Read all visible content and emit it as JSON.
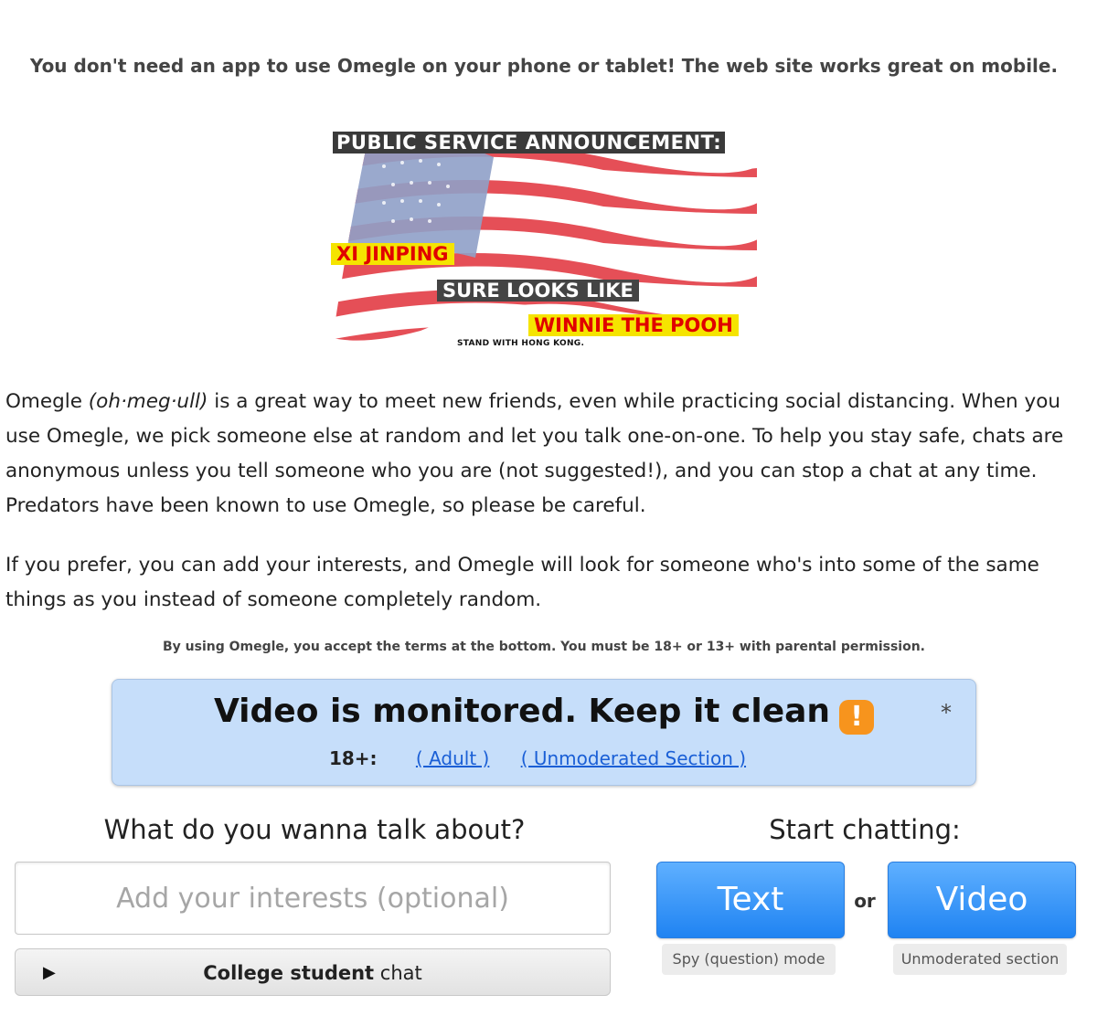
{
  "mobile_note": "You don't need an app to use Omegle on your phone or tablet! The web site works great on mobile.",
  "psa": {
    "title": "PUBLIC SERVICE ANNOUNCEMENT:",
    "line1": "XI JINPING",
    "line2": "SURE LOOKS LIKE",
    "line3": "WINNIE THE POOH",
    "small": "STAND WITH HONG KONG."
  },
  "intro": {
    "lead": "Omegle ",
    "pronunciation": "(oh·meg·ull)",
    "rest": " is a great way to meet new friends, even while practicing social distancing. When you use Omegle, we pick someone else at random and let you talk one-on-one. To help you stay safe, chats are anonymous unless you tell someone who you are (not suggested!), and you can stop a chat at any time. Predators have been known to use Omegle, so please be careful."
  },
  "interests_paragraph": "If you prefer, you can add your interests, and Omegle will look for someone who's into some of the same things as you instead of someone completely random.",
  "terms_note": "By using Omegle, you accept the terms at the bottom. You must be 18+ or 13+ with parental permission.",
  "monitor": {
    "title": "Video is monitored. Keep it clean",
    "warning_glyph": "!",
    "asterisk": "*",
    "age_label": "18+:",
    "adult_link": "( Adult )",
    "unmoderated_link": "( Unmoderated Section )"
  },
  "talk": {
    "heading": "What do you wanna talk about?",
    "input_placeholder": "Add your interests (optional)",
    "input_value": "",
    "college_bold": "College student",
    "college_rest": " chat"
  },
  "start": {
    "heading": "Start chatting:",
    "text_button": "Text",
    "or_label": "or",
    "video_button": "Video",
    "spy_mode": "Spy (question) mode",
    "unmoderated_section": "Unmoderated section"
  },
  "colors": {
    "button_blue": "#1f83f2",
    "monitor_bg": "#c6defa",
    "warning_orange": "#f7941d",
    "link_blue": "#1a5fd6"
  },
  "icons": {
    "warning": "warning-icon",
    "college_toggle": "play-triangle-icon"
  }
}
